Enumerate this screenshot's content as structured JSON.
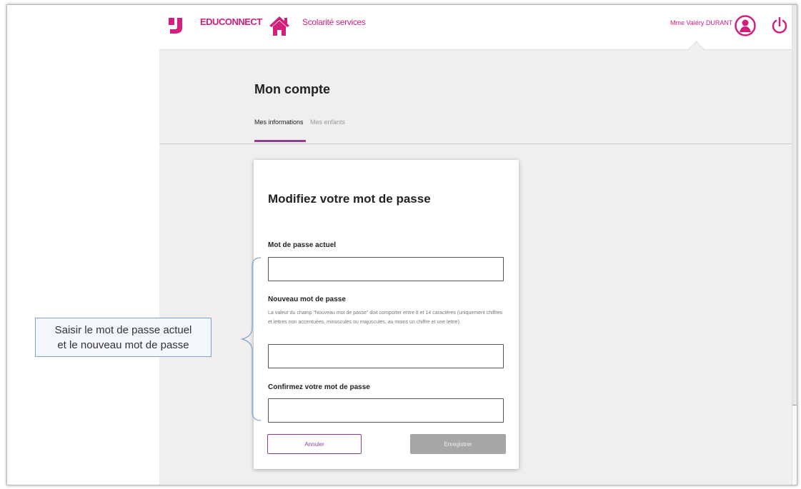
{
  "header": {
    "brand": "EDUCONNECT",
    "service": "Scolarité services",
    "user_name": "Mme Valéry DURANT"
  },
  "page": {
    "title": "Mon compte",
    "tabs": [
      {
        "label": "Mes informations",
        "active": true
      },
      {
        "label": "Mes enfants",
        "active": false
      }
    ]
  },
  "form": {
    "title": "Modifiez votre mot de passe",
    "current_label": "Mot de passe actuel",
    "new_label": "Nouveau mot de passe",
    "help": "La valeur du champ \"Nouveau mot de passe\" doit comporter entre 8 et 14 caractères (uniquement chiffres et lettres non accentuées, minuscules ou majuscules, au moins un chiffre et une lettre).",
    "confirm_label": "Confirmez votre mot de passe",
    "cancel": "Annuler",
    "save": "Enregistrer"
  },
  "callout": {
    "line1": "Saisir le mot de passe actuel",
    "line2": "et le nouveau mot de passe"
  },
  "colors": {
    "brand": "#d21f7b",
    "accent": "#8e3f8e",
    "disabled": "#a6a6a6"
  },
  "icons": [
    "educonnect-logo",
    "home-icon",
    "user-avatar-icon",
    "power-icon"
  ]
}
